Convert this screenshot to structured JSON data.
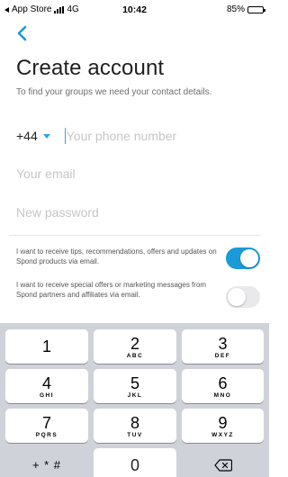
{
  "status_bar": {
    "back_app": "App Store",
    "network": "4G",
    "time": "10:42",
    "battery": "85%"
  },
  "header": {
    "title": "Create account",
    "subtitle": "To find your groups we need your contact details."
  },
  "form": {
    "country_code": "+44",
    "phone_placeholder": "Your phone number",
    "email_placeholder": "Your email",
    "password_placeholder": "New password"
  },
  "options": [
    {
      "text": "I want to receive tips, recommendations, offers and updates on Spond products via email.",
      "enabled": true
    },
    {
      "text": "I want to receive special offers or marketing messages from Spond partners and affiliates via email.",
      "enabled": false
    }
  ],
  "colors": {
    "accent": "#1a9bd7",
    "toggle_off": "#e9e9eb",
    "keyboard_bg": "#cfd3d9"
  },
  "keypad": {
    "keys": [
      {
        "num": "1",
        "letters": ""
      },
      {
        "num": "2",
        "letters": "ABC"
      },
      {
        "num": "3",
        "letters": "DEF"
      },
      {
        "num": "4",
        "letters": "GHI"
      },
      {
        "num": "5",
        "letters": "JKL"
      },
      {
        "num": "6",
        "letters": "MNO"
      },
      {
        "num": "7",
        "letters": "PQRS"
      },
      {
        "num": "8",
        "letters": "TUV"
      },
      {
        "num": "9",
        "letters": "WXYZ"
      }
    ],
    "symbols": "+ * #",
    "zero": "0",
    "delete_icon": "backspace-icon"
  }
}
